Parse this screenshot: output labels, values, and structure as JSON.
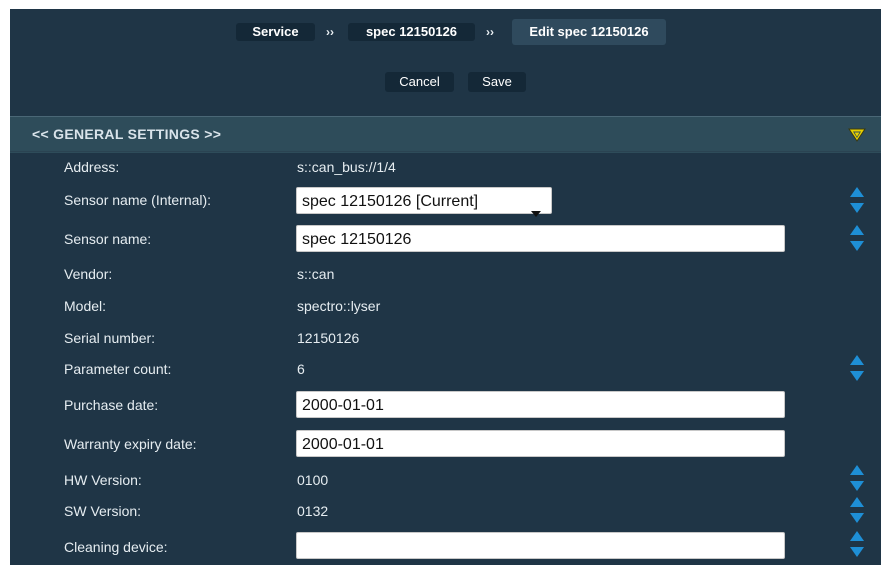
{
  "breadcrumb": {
    "items": [
      "Service",
      "spec 12150126",
      "Edit spec 12150126"
    ],
    "separator": "››"
  },
  "actions": {
    "cancel_label": "Cancel",
    "save_label": "Save"
  },
  "section": {
    "title": "<< GENERAL SETTINGS >>",
    "toggle_icon": "triangle-down-icon",
    "toggle_color": "#e8d000"
  },
  "fields": {
    "address": {
      "label": "Address:",
      "value": "s::can_bus://1/4"
    },
    "sensor_name_internal": {
      "label": "Sensor name (Internal):",
      "selected": "spec 12150126 [Current]"
    },
    "sensor_name": {
      "label": "Sensor name:",
      "value": "spec 12150126"
    },
    "vendor": {
      "label": "Vendor:",
      "value": "s::can"
    },
    "model": {
      "label": "Model:",
      "value": "spectro::lyser"
    },
    "serial_number": {
      "label": "Serial number:",
      "value": "12150126"
    },
    "parameter_count": {
      "label": "Parameter count:",
      "value": "6"
    },
    "purchase_date": {
      "label": "Purchase date:",
      "value": "2000-01-01"
    },
    "warranty_expiry_date": {
      "label": "Warranty expiry date:",
      "value": "2000-01-01"
    },
    "hw_version": {
      "label": "HW Version:",
      "value": "0100"
    },
    "sw_version": {
      "label": "SW Version:",
      "value": "0132"
    },
    "cleaning_device": {
      "label": "Cleaning device:",
      "value": ""
    }
  },
  "colors": {
    "panel_bg": "#1f3546",
    "section_bg": "#2e4c5a",
    "sort_arrow": "#1e8fd6"
  },
  "icons": {
    "sort": "sort-up-down-icon",
    "dropdown": "dropdown-caret-icon"
  }
}
